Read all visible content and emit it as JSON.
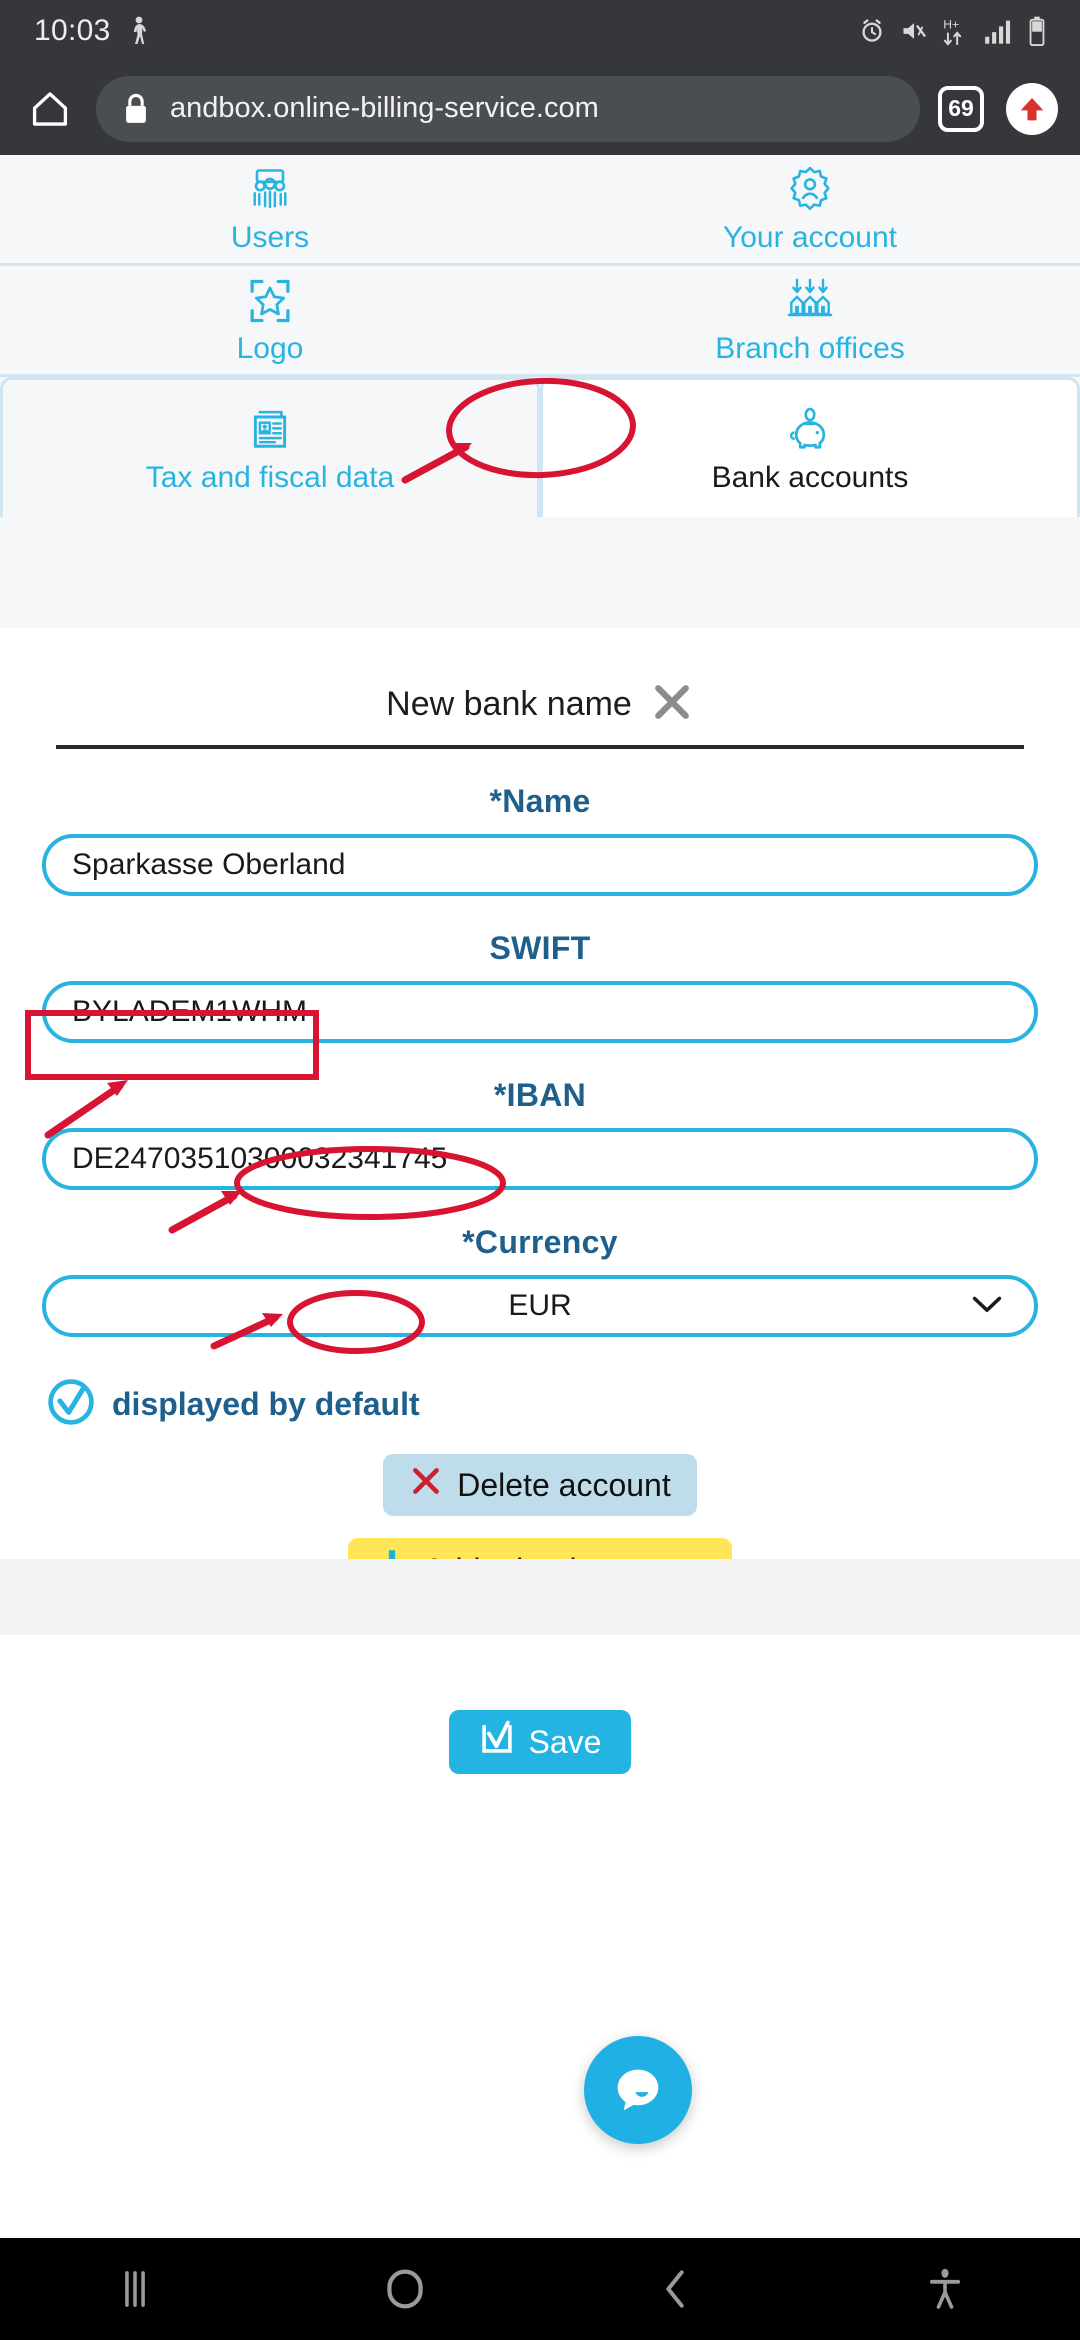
{
  "status_bar": {
    "clock": "10:03",
    "icons": [
      "walking-person-icon",
      "alarm-icon",
      "mute-vibrate-icon",
      "hplus-data-icon",
      "signal-bars-icon",
      "battery-icon"
    ]
  },
  "browser": {
    "home_icon": "home-icon",
    "lock_icon": "lock-icon",
    "url": "andbox.online-billing-service.com",
    "tab_count": "69",
    "update_icon": "up-arrow-icon"
  },
  "nav_tabs": [
    {
      "label": "Users",
      "icon": "users-group-icon",
      "active": false
    },
    {
      "label": "Your account",
      "icon": "account-gear-icon",
      "active": false
    },
    {
      "label": "Logo",
      "icon": "logo-star-frame-icon",
      "active": false
    },
    {
      "label": "Branch offices",
      "icon": "branch-offices-icon",
      "active": false
    },
    {
      "label": "Tax and fiscal data",
      "icon": "tax-documents-icon",
      "active": false
    },
    {
      "label": "Bank accounts",
      "icon": "piggy-bank-icon",
      "active": true
    }
  ],
  "bank_form": {
    "title": "New bank name",
    "close_icon": "close-x-icon",
    "fields": [
      {
        "label": "Name",
        "required": true,
        "required_mark": "*",
        "value": "Sparkasse Oberland",
        "type": "text"
      },
      {
        "label": "SWIFT",
        "required": false,
        "required_mark": "",
        "value": "BYLADEM1WHM",
        "type": "text"
      },
      {
        "label": "IBAN",
        "required": true,
        "required_mark": "*",
        "value": "DE24703510300032341745",
        "type": "text"
      },
      {
        "label": "Currency",
        "required": true,
        "required_mark": "*",
        "value": "EUR",
        "type": "select"
      }
    ],
    "default_checkbox": {
      "label": "displayed by default",
      "checked": true,
      "icon": "circle-check-icon"
    },
    "buttons": [
      {
        "label": "Delete account",
        "icon": "red-x-icon",
        "style": "light-blue"
      },
      {
        "label": "Add a bank account",
        "icon": "plus-icon",
        "style": "yellow"
      },
      {
        "label": "Add a bank",
        "icon": "plus-icon",
        "style": "yellow"
      },
      {
        "label": "Save",
        "icon": "checkbox-check-icon",
        "style": "cyan"
      }
    ]
  },
  "chat_widget": {
    "icon": "chat-bubble-icon"
  },
  "android_nav": [
    {
      "icon": "recents-icon"
    },
    {
      "icon": "home-circle-icon"
    },
    {
      "icon": "back-chevron-icon"
    },
    {
      "icon": "accessibility-icon"
    }
  ],
  "annotations": {
    "color": "#d81433",
    "shapes": [
      {
        "kind": "ellipse",
        "target": "bank-accounts-tab"
      },
      {
        "kind": "arrow",
        "target": "bank-accounts-tab"
      },
      {
        "kind": "rectangle",
        "target": "displayed-by-default-checkbox"
      },
      {
        "kind": "arrow",
        "target": "displayed-by-default-checkbox"
      },
      {
        "kind": "ellipse",
        "target": "add-bank-account-button"
      },
      {
        "kind": "arrow",
        "target": "add-bank-account-button"
      },
      {
        "kind": "ellipse",
        "target": "save-button"
      },
      {
        "kind": "arrow",
        "target": "save-button"
      }
    ]
  },
  "colors": {
    "accent_cyan": "#29b3e0",
    "label_navy": "#1f5f8b",
    "yellow_button": "#ffe658",
    "light_blue_button": "#bfdcea",
    "annotation_red": "#d81433",
    "chrome_dark": "#35373b"
  }
}
